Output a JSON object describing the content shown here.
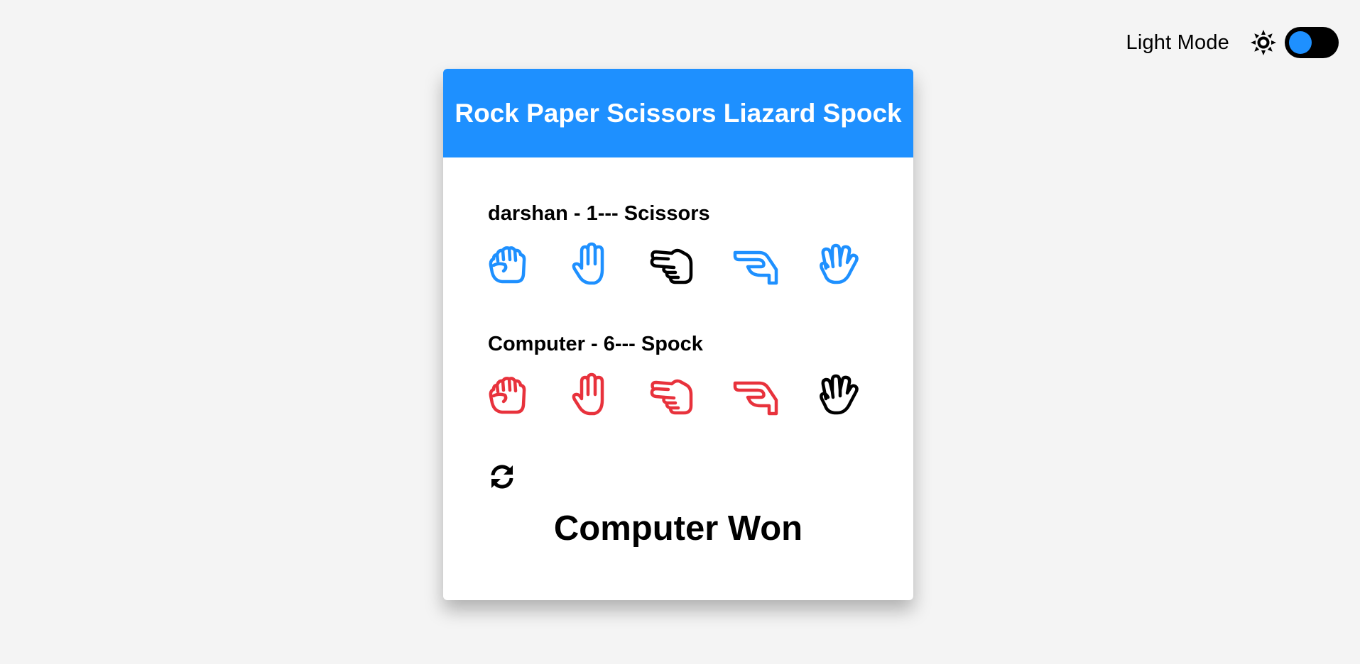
{
  "theme": {
    "label": "Light Mode",
    "sun_icon": "sun-icon",
    "toggle_color": "#1e90ff"
  },
  "game": {
    "title": "Rock Paper Scissors Liazard Spock",
    "header_color": "#1e90ff",
    "player": {
      "name": "darshan",
      "score_label": "darshan - 1--- Scissors",
      "color": "#1e90ff",
      "selected": "Scissors",
      "choices": [
        "Rock",
        "Paper",
        "Scissors",
        "Lizard",
        "Spock"
      ]
    },
    "computer": {
      "name": "Computer",
      "score_label": "Computer - 6--- Spock",
      "color": "#e8323c",
      "selected": "Spock",
      "choices": [
        "Rock",
        "Paper",
        "Scissors",
        "Lizard",
        "Spock"
      ]
    },
    "refresh_icon": "refresh-icon",
    "result": "Computer Won"
  }
}
